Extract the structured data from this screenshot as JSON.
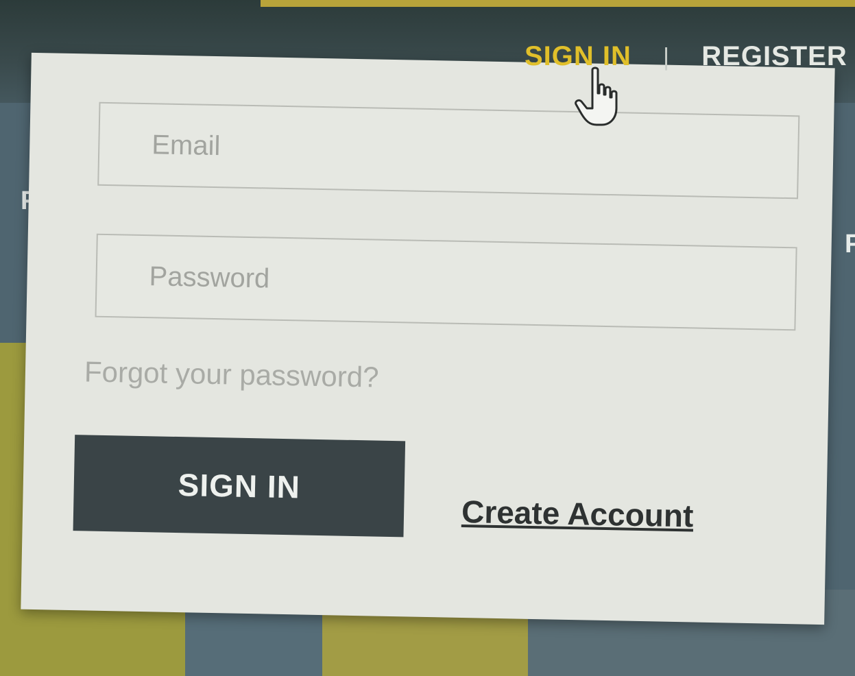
{
  "header": {
    "nav": {
      "signin_label": "SIGN IN",
      "separator": "|",
      "register_label": "REGISTER"
    },
    "background_letters": [
      "F",
      "F"
    ]
  },
  "login_popup": {
    "email_placeholder": "Email",
    "password_placeholder": "Password",
    "forgot_password_label": "Forgot your password?",
    "signin_button_label": "SIGN IN",
    "create_account_label": "Create Account"
  },
  "cursor": {
    "icon": "hand-pointer-icon"
  },
  "colors": {
    "nav_active": "#e0bf2a",
    "button_bg": "#3a4447",
    "popup_bg": "#e4e6e0"
  }
}
